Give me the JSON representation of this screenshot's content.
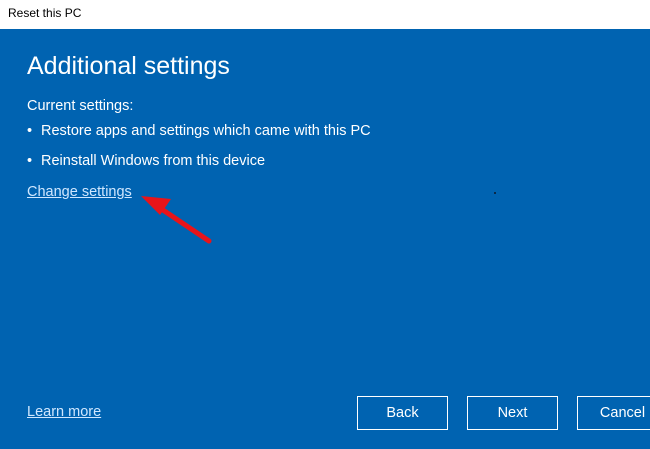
{
  "window": {
    "title": "Reset this PC"
  },
  "main": {
    "heading": "Additional settings",
    "current_settings_label": "Current settings:",
    "bullet_glyph": "•",
    "settings": [
      "Restore apps and settings which came with this PC",
      "Reinstall Windows from this device"
    ],
    "change_settings_link": "Change settings"
  },
  "footer": {
    "learn_more_link": "Learn more",
    "back_label": "Back",
    "next_label": "Next",
    "cancel_label": "Cancel"
  },
  "colors": {
    "background": "#0063b1",
    "text": "#ffffff",
    "link": "#cfe7ff",
    "annotation_arrow": "#e8141a"
  }
}
